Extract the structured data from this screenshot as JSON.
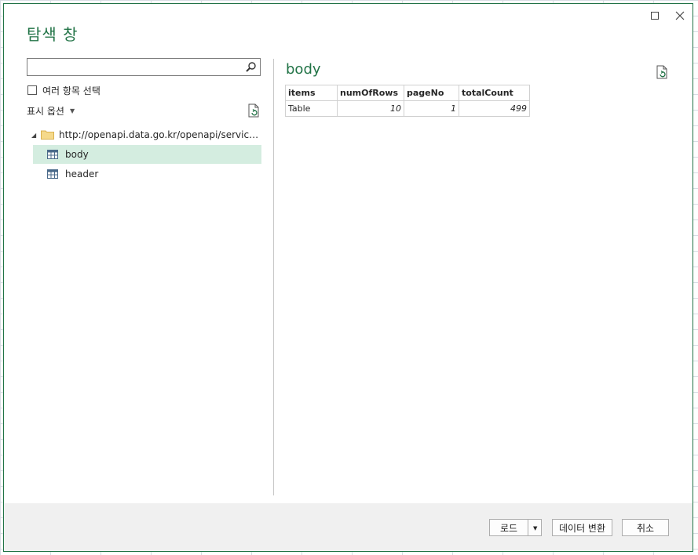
{
  "dialog": {
    "title": "탐색 창"
  },
  "left_pane": {
    "search": {
      "value": "",
      "placeholder": ""
    },
    "multi_select_label": "여러 항목 선택",
    "display_options_label": "표시 옵션",
    "tree": {
      "root_label": "http://openapi.data.go.kr/openapi/service/rest...",
      "items": [
        {
          "label": "body",
          "selected": true
        },
        {
          "label": "header",
          "selected": false
        }
      ]
    }
  },
  "preview": {
    "title": "body",
    "columns": [
      "items",
      "numOfRows",
      "pageNo",
      "totalCount"
    ],
    "rows": [
      [
        "Table",
        "10",
        "1",
        "499"
      ]
    ]
  },
  "footer": {
    "load_label": "로드",
    "transform_label": "데이터 변환",
    "cancel_label": "취소"
  },
  "colors": {
    "accent": "#217346",
    "selection": "#d4ede0",
    "footer_bg": "#f0f0f0"
  },
  "icons": {
    "close": "close-icon",
    "maximize": "maximize-icon",
    "search": "search-icon",
    "refresh": "refresh-icon",
    "folder": "folder-icon",
    "table": "table-icon"
  }
}
